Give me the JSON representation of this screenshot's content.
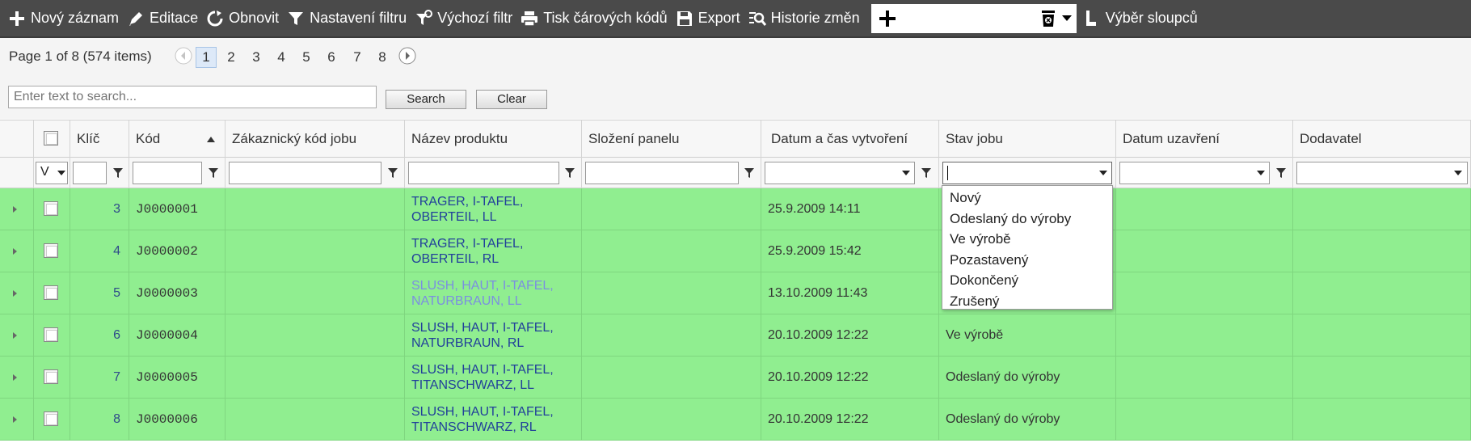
{
  "toolbar": {
    "new_record": "Nový záznam",
    "edit": "Editace",
    "refresh": "Obnovit",
    "filter_settings": "Nastavení filtru",
    "default_filter": "Výchozí filtr",
    "print_barcodes": "Tisk čárových kódů",
    "export": "Export",
    "history": "Historie změn",
    "columns": "Výběr sloupců"
  },
  "pager": {
    "info": "Page 1 of 8 (574 items)",
    "pages": [
      "1",
      "2",
      "3",
      "4",
      "5",
      "6",
      "7",
      "8"
    ],
    "current": "1"
  },
  "search": {
    "placeholder": "Enter text to search...",
    "search_label": "Search",
    "clear_label": "Clear"
  },
  "grid": {
    "columns": [
      "Klíč",
      "Kód",
      "Zákaznický kód jobu",
      "Název produktu",
      "Složení panelu",
      "Datum a čas vytvoření",
      "Stav jobu",
      "Datum uzavření",
      "Dodavatel"
    ],
    "select_filter_value": "V",
    "rows": [
      {
        "key": "3",
        "code": "J0000001",
        "product": "TRAGER, I-TAFEL, OBERTEIL, LL",
        "created": "25.9.2009 14:11",
        "state": ""
      },
      {
        "key": "4",
        "code": "J0000002",
        "product": "TRAGER, I-TAFEL, OBERTEIL, RL",
        "created": "25.9.2009 15:42",
        "state": ""
      },
      {
        "key": "5",
        "code": "J0000003",
        "product": "SLUSH, HAUT, I-TAFEL, NATURBRAUN, LL",
        "created": "13.10.2009 11:43",
        "state": ""
      },
      {
        "key": "6",
        "code": "J0000004",
        "product": "SLUSH, HAUT, I-TAFEL, NATURBRAUN, RL",
        "created": "20.10.2009 12:22",
        "state": "Ve výrobě"
      },
      {
        "key": "7",
        "code": "J0000005",
        "product": "SLUSH, HAUT, I-TAFEL, TITANSCHWARZ, LL",
        "created": "20.10.2009 12:22",
        "state": "Odeslaný do výroby"
      },
      {
        "key": "8",
        "code": "J0000006",
        "product": "SLUSH, HAUT, I-TAFEL, TITANSCHWARZ, RL",
        "created": "20.10.2009 12:22",
        "state": "Odeslaný do výroby"
      }
    ]
  },
  "state_dropdown": {
    "options": [
      "Nový",
      "Odeslaný do výroby",
      "Ve výrobě",
      "Pozastavený",
      "Dokončený",
      "Zrušený"
    ]
  },
  "colors": {
    "toolbar_bg": "#4a4a4a",
    "row_bg": "#90ee90",
    "link": "#21409a",
    "link_visited": "#7b8fe0"
  }
}
